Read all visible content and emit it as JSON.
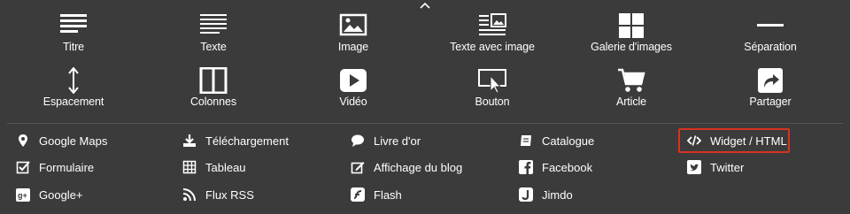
{
  "close_icon": "close-icon",
  "top_tiles": [
    {
      "label": "Titre",
      "icon": "heading-icon"
    },
    {
      "label": "Texte",
      "icon": "text-icon"
    },
    {
      "label": "Image",
      "icon": "image-icon"
    },
    {
      "label": "Texte avec image",
      "icon": "text-with-image-icon"
    },
    {
      "label": "Galerie d'images",
      "icon": "gallery-icon"
    },
    {
      "label": "Séparation",
      "icon": "separator-icon"
    },
    {
      "label": "Espacement",
      "icon": "spacing-icon"
    },
    {
      "label": "Colonnes",
      "icon": "columns-icon"
    },
    {
      "label": "Vidéo",
      "icon": "video-icon"
    },
    {
      "label": "Bouton",
      "icon": "button-icon"
    },
    {
      "label": "Article",
      "icon": "cart-icon"
    },
    {
      "label": "Partager",
      "icon": "share-icon"
    }
  ],
  "links": [
    {
      "label": "Google Maps",
      "icon": "map-pin-icon"
    },
    {
      "label": "Formulaire",
      "icon": "form-check-icon"
    },
    {
      "label": "Google+",
      "icon": "google-plus-icon"
    },
    {
      "label": "Téléchargement",
      "icon": "download-icon"
    },
    {
      "label": "Tableau",
      "icon": "table-icon"
    },
    {
      "label": "Flux RSS",
      "icon": "rss-icon"
    },
    {
      "label": "Livre d'or",
      "icon": "speech-bubble-icon"
    },
    {
      "label": "Affichage du blog",
      "icon": "blog-edit-icon"
    },
    {
      "label": "Flash",
      "icon": "flash-icon"
    },
    {
      "label": "Catalogue",
      "icon": "catalogue-icon"
    },
    {
      "label": "Facebook",
      "icon": "facebook-icon"
    },
    {
      "label": "Jimdo",
      "icon": "jimdo-icon"
    },
    {
      "label": "Widget / HTML",
      "icon": "code-icon"
    },
    {
      "label": "Twitter",
      "icon": "twitter-icon"
    }
  ],
  "colors": {
    "background": "#3b3b3b",
    "highlight": "#d6331f",
    "text": "#ffffff"
  }
}
